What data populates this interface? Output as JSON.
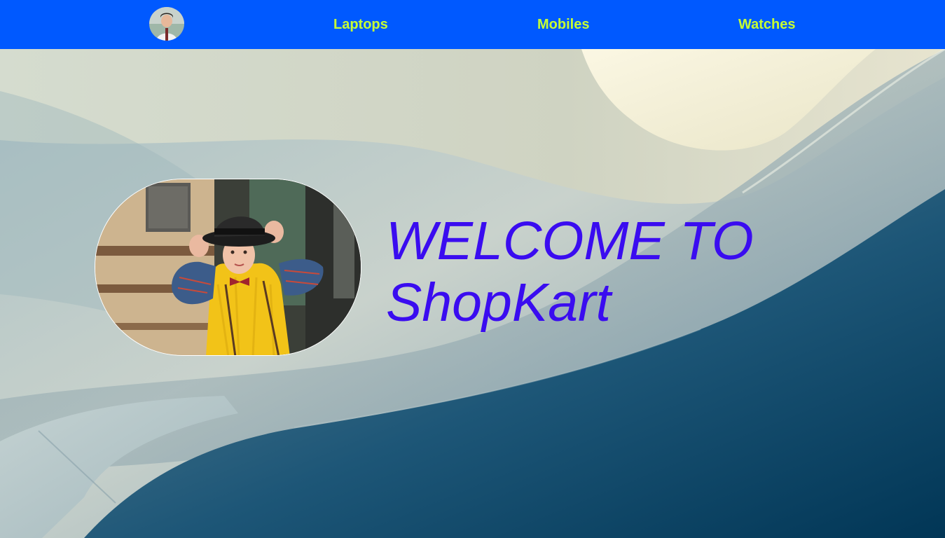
{
  "colors": {
    "navbar_bg": "#0059ff",
    "nav_link": "#c6ff33",
    "heading": "#3a0cf0"
  },
  "navbar": {
    "logo_icon": "profile-avatar-icon",
    "links": [
      {
        "label": "Laptops"
      },
      {
        "label": "Mobiles"
      },
      {
        "label": "Watches"
      }
    ]
  },
  "hero": {
    "heading_line1": "WELCOME TO",
    "heading_line2": "ShopKart",
    "photo_icon": "boy-in-hat-photo",
    "background_icon": "abstract-curved-wall-background"
  }
}
